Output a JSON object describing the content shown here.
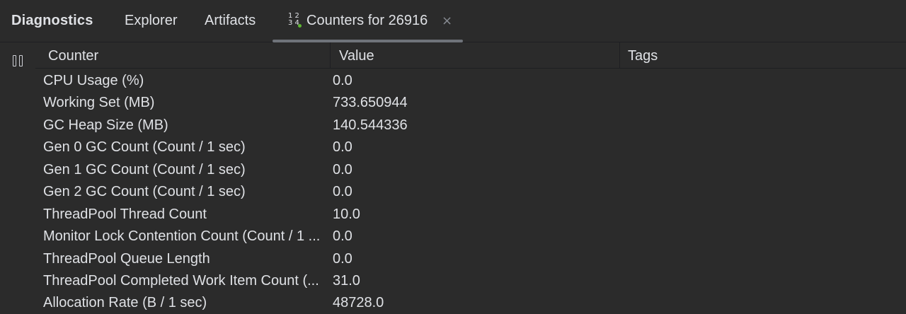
{
  "toolwindow": {
    "title": "Diagnostics"
  },
  "tabs": {
    "explorer": "Explorer",
    "artifacts": "Artifacts",
    "counters": {
      "label": "Counters for 26916",
      "icon": "counters-icon",
      "icon_glyph_top": "1 2",
      "icon_glyph_bottom": "3 4",
      "close": "×"
    }
  },
  "toolbar": {
    "pause_icon": "pause-icon"
  },
  "table": {
    "columns": {
      "counter": "Counter",
      "value": "Value",
      "tags": "Tags"
    },
    "rows": [
      {
        "name": "CPU Usage (%)",
        "value": "0.0",
        "tags": ""
      },
      {
        "name": "Working Set (MB)",
        "value": "733.650944",
        "tags": ""
      },
      {
        "name": "GC Heap Size (MB)",
        "value": "140.544336",
        "tags": ""
      },
      {
        "name": "Gen 0 GC Count (Count / 1 sec)",
        "value": "0.0",
        "tags": ""
      },
      {
        "name": "Gen 1 GC Count (Count / 1 sec)",
        "value": "0.0",
        "tags": ""
      },
      {
        "name": "Gen 2 GC Count (Count / 1 sec)",
        "value": "0.0",
        "tags": ""
      },
      {
        "name": "ThreadPool Thread Count",
        "value": "10.0",
        "tags": ""
      },
      {
        "name": "Monitor Lock Contention Count (Count / 1 ...",
        "value": "0.0",
        "tags": ""
      },
      {
        "name": "ThreadPool Queue Length",
        "value": "0.0",
        "tags": ""
      },
      {
        "name": "ThreadPool Completed Work Item Count (...",
        "value": "31.0",
        "tags": ""
      },
      {
        "name": "Allocation Rate (B / 1 sec)",
        "value": "48728.0",
        "tags": ""
      }
    ]
  },
  "colors": {
    "background": "#2b2b2b",
    "text": "#dfe1e5",
    "active_tab_underline": "#6f737a",
    "status_dot": "#5fb832"
  }
}
